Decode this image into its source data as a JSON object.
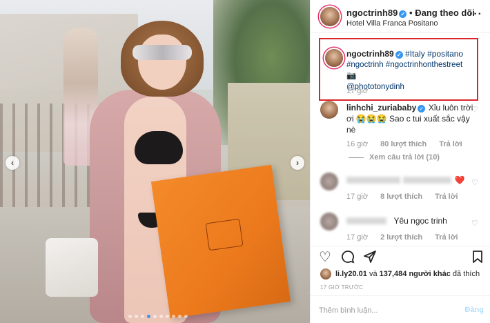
{
  "post": {
    "username": "ngoctrinh89",
    "follow_status": "Đang theo dõi",
    "separator": "•",
    "location": "Hotel Villa Franca Positano"
  },
  "caption": {
    "username": "ngoctrinh89",
    "text_parts": [
      "#Italy",
      "#positano",
      "#ngoctrinh",
      "#ngoctrinhonthestreet",
      "📷",
      "@phototonydinh"
    ],
    "time": "17 giờ"
  },
  "comments": [
    {
      "username": "linhchi_zuriababy",
      "text_line1": "Xỉu luôn trời",
      "text_line2": "ơi 😭😭😭 Sao c tui xuất sắc vậy",
      "text_line3": "nè",
      "time": "16 giờ",
      "likes": "80 lượt thích",
      "reply": "Trả lời",
      "view_replies": "Xem câu trả lời (10)"
    },
    {
      "username": "",
      "text": "❤️",
      "time": "17 giờ",
      "likes": "8 lượt thích",
      "reply": "Trả lời"
    },
    {
      "username": "",
      "text": "Yêu ngọc trinh",
      "time": "17 giờ",
      "likes": "2 lượt thích",
      "reply": "Trả lời"
    }
  ],
  "liked_by": {
    "user": "li.ly20.01",
    "rest": "và",
    "count": "137,484 người khác",
    "suffix": "đã thích"
  },
  "posted_ago": "17 GIỜ TRƯỚC",
  "add_comment": {
    "placeholder": "Thêm bình luận...",
    "post_label": "Đăng"
  },
  "colors": {
    "highlight_border": "#d9262b",
    "hashtag": "#003569",
    "verified": "#3897f0",
    "muted": "#999999",
    "post_button": "#b2dffc",
    "bag": "#f48a2a"
  },
  "icons": [
    "more-options-icon",
    "heart-icon",
    "comment-icon",
    "share-icon",
    "bookmark-icon",
    "verified-badge-icon",
    "chevron-left-icon",
    "chevron-right-icon"
  ]
}
